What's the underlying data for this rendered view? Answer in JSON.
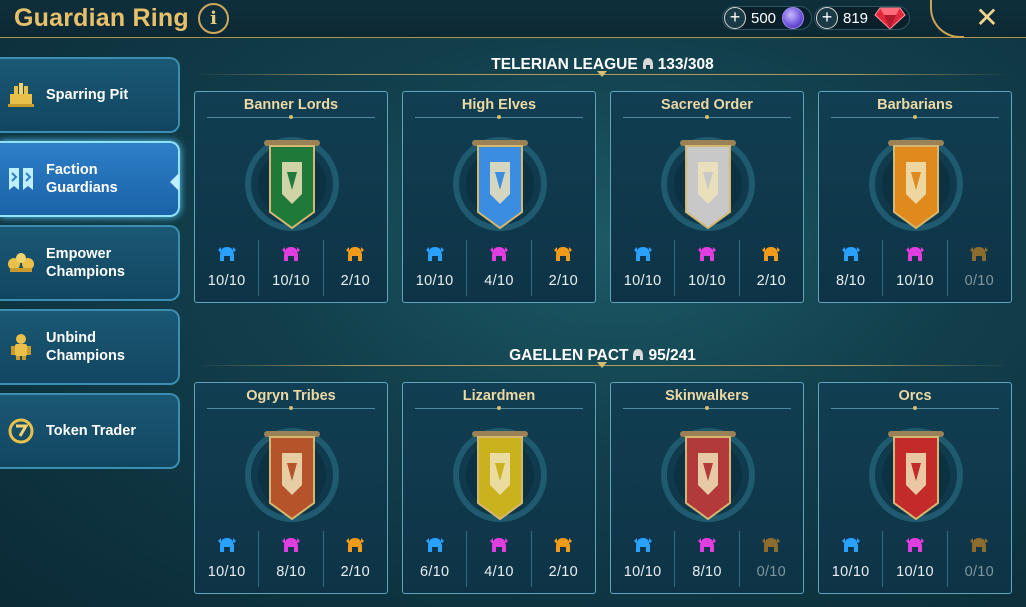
{
  "header": {
    "title": "Guardian Ring",
    "info_label": "i",
    "currency": [
      {
        "name": "energy",
        "amount": "500",
        "icon": "blue-gem-icon",
        "color": "#7b5cff"
      },
      {
        "name": "gems",
        "amount": "819",
        "icon": "red-gem-icon",
        "color": "#e0283a"
      }
    ],
    "close_label": "✕"
  },
  "sidebar": {
    "items": [
      {
        "label": "Sparring Pit",
        "icon": "sparring-pit-icon",
        "active": false
      },
      {
        "label": "Faction\nGuardians",
        "icon": "faction-guardians-icon",
        "active": true
      },
      {
        "label": "Empower\nChampions",
        "icon": "empower-champions-icon",
        "active": false
      },
      {
        "label": "Unbind\nChampions",
        "icon": "unbind-champions-icon",
        "active": false
      },
      {
        "label": "Token Trader",
        "icon": "token-trader-icon",
        "active": false
      }
    ]
  },
  "rarity_colors": {
    "rare": "#29a2ff",
    "epic": "#e13ee0",
    "legendary": "#f29a1a"
  },
  "sections": [
    {
      "title": "TELERIAN LEAGUE",
      "progress": "133/308",
      "factions": [
        {
          "name": "Banner Lords",
          "banner_color": "#1f7a3a",
          "rare": "10/10",
          "epic": "10/10",
          "legendary": "2/10"
        },
        {
          "name": "High Elves",
          "banner_color": "#3a8de0",
          "rare": "10/10",
          "epic": "4/10",
          "legendary": "2/10"
        },
        {
          "name": "Sacred Order",
          "banner_color": "#c8c8c8",
          "rare": "10/10",
          "epic": "10/10",
          "legendary": "2/10"
        },
        {
          "name": "Barbarians",
          "banner_color": "#e08a1e",
          "rare": "8/10",
          "epic": "10/10",
          "legendary": "0/10"
        }
      ]
    },
    {
      "title": "GAELLEN PACT",
      "progress": "95/241",
      "factions": [
        {
          "name": "Ogryn Tribes",
          "banner_color": "#b5532a",
          "rare": "10/10",
          "epic": "8/10",
          "legendary": "2/10"
        },
        {
          "name": "Lizardmen",
          "banner_color": "#c9b21e",
          "rare": "6/10",
          "epic": "4/10",
          "legendary": "2/10"
        },
        {
          "name": "Skinwalkers",
          "banner_color": "#b23a3a",
          "rare": "10/10",
          "epic": "8/10",
          "legendary": "0/10"
        },
        {
          "name": "Orcs",
          "banner_color": "#c32b2b",
          "rare": "10/10",
          "epic": "10/10",
          "legendary": "0/10"
        }
      ]
    }
  ]
}
